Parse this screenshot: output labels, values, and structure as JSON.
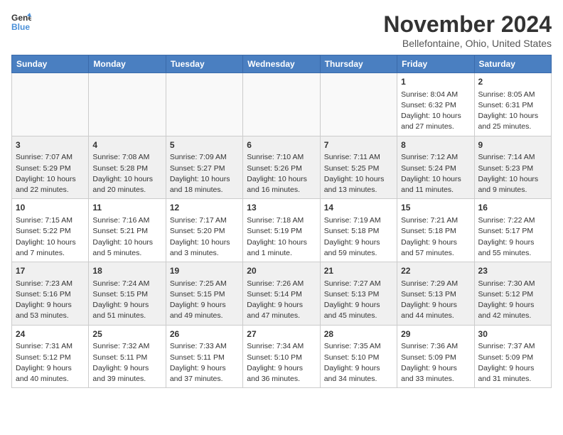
{
  "logo": {
    "line1": "General",
    "line2": "Blue"
  },
  "title": "November 2024",
  "subtitle": "Bellefontaine, Ohio, United States",
  "weekdays": [
    "Sunday",
    "Monday",
    "Tuesday",
    "Wednesday",
    "Thursday",
    "Friday",
    "Saturday"
  ],
  "weeks": [
    [
      {
        "day": "",
        "info": ""
      },
      {
        "day": "",
        "info": ""
      },
      {
        "day": "",
        "info": ""
      },
      {
        "day": "",
        "info": ""
      },
      {
        "day": "",
        "info": ""
      },
      {
        "day": "1",
        "info": "Sunrise: 8:04 AM\nSunset: 6:32 PM\nDaylight: 10 hours\nand 27 minutes."
      },
      {
        "day": "2",
        "info": "Sunrise: 8:05 AM\nSunset: 6:31 PM\nDaylight: 10 hours\nand 25 minutes."
      }
    ],
    [
      {
        "day": "3",
        "info": "Sunrise: 7:07 AM\nSunset: 5:29 PM\nDaylight: 10 hours\nand 22 minutes."
      },
      {
        "day": "4",
        "info": "Sunrise: 7:08 AM\nSunset: 5:28 PM\nDaylight: 10 hours\nand 20 minutes."
      },
      {
        "day": "5",
        "info": "Sunrise: 7:09 AM\nSunset: 5:27 PM\nDaylight: 10 hours\nand 18 minutes."
      },
      {
        "day": "6",
        "info": "Sunrise: 7:10 AM\nSunset: 5:26 PM\nDaylight: 10 hours\nand 16 minutes."
      },
      {
        "day": "7",
        "info": "Sunrise: 7:11 AM\nSunset: 5:25 PM\nDaylight: 10 hours\nand 13 minutes."
      },
      {
        "day": "8",
        "info": "Sunrise: 7:12 AM\nSunset: 5:24 PM\nDaylight: 10 hours\nand 11 minutes."
      },
      {
        "day": "9",
        "info": "Sunrise: 7:14 AM\nSunset: 5:23 PM\nDaylight: 10 hours\nand 9 minutes."
      }
    ],
    [
      {
        "day": "10",
        "info": "Sunrise: 7:15 AM\nSunset: 5:22 PM\nDaylight: 10 hours\nand 7 minutes."
      },
      {
        "day": "11",
        "info": "Sunrise: 7:16 AM\nSunset: 5:21 PM\nDaylight: 10 hours\nand 5 minutes."
      },
      {
        "day": "12",
        "info": "Sunrise: 7:17 AM\nSunset: 5:20 PM\nDaylight: 10 hours\nand 3 minutes."
      },
      {
        "day": "13",
        "info": "Sunrise: 7:18 AM\nSunset: 5:19 PM\nDaylight: 10 hours\nand 1 minute."
      },
      {
        "day": "14",
        "info": "Sunrise: 7:19 AM\nSunset: 5:18 PM\nDaylight: 9 hours\nand 59 minutes."
      },
      {
        "day": "15",
        "info": "Sunrise: 7:21 AM\nSunset: 5:18 PM\nDaylight: 9 hours\nand 57 minutes."
      },
      {
        "day": "16",
        "info": "Sunrise: 7:22 AM\nSunset: 5:17 PM\nDaylight: 9 hours\nand 55 minutes."
      }
    ],
    [
      {
        "day": "17",
        "info": "Sunrise: 7:23 AM\nSunset: 5:16 PM\nDaylight: 9 hours\nand 53 minutes."
      },
      {
        "day": "18",
        "info": "Sunrise: 7:24 AM\nSunset: 5:15 PM\nDaylight: 9 hours\nand 51 minutes."
      },
      {
        "day": "19",
        "info": "Sunrise: 7:25 AM\nSunset: 5:15 PM\nDaylight: 9 hours\nand 49 minutes."
      },
      {
        "day": "20",
        "info": "Sunrise: 7:26 AM\nSunset: 5:14 PM\nDaylight: 9 hours\nand 47 minutes."
      },
      {
        "day": "21",
        "info": "Sunrise: 7:27 AM\nSunset: 5:13 PM\nDaylight: 9 hours\nand 45 minutes."
      },
      {
        "day": "22",
        "info": "Sunrise: 7:29 AM\nSunset: 5:13 PM\nDaylight: 9 hours\nand 44 minutes."
      },
      {
        "day": "23",
        "info": "Sunrise: 7:30 AM\nSunset: 5:12 PM\nDaylight: 9 hours\nand 42 minutes."
      }
    ],
    [
      {
        "day": "24",
        "info": "Sunrise: 7:31 AM\nSunset: 5:12 PM\nDaylight: 9 hours\nand 40 minutes."
      },
      {
        "day": "25",
        "info": "Sunrise: 7:32 AM\nSunset: 5:11 PM\nDaylight: 9 hours\nand 39 minutes."
      },
      {
        "day": "26",
        "info": "Sunrise: 7:33 AM\nSunset: 5:11 PM\nDaylight: 9 hours\nand 37 minutes."
      },
      {
        "day": "27",
        "info": "Sunrise: 7:34 AM\nSunset: 5:10 PM\nDaylight: 9 hours\nand 36 minutes."
      },
      {
        "day": "28",
        "info": "Sunrise: 7:35 AM\nSunset: 5:10 PM\nDaylight: 9 hours\nand 34 minutes."
      },
      {
        "day": "29",
        "info": "Sunrise: 7:36 AM\nSunset: 5:09 PM\nDaylight: 9 hours\nand 33 minutes."
      },
      {
        "day": "30",
        "info": "Sunrise: 7:37 AM\nSunset: 5:09 PM\nDaylight: 9 hours\nand 31 minutes."
      }
    ]
  ]
}
